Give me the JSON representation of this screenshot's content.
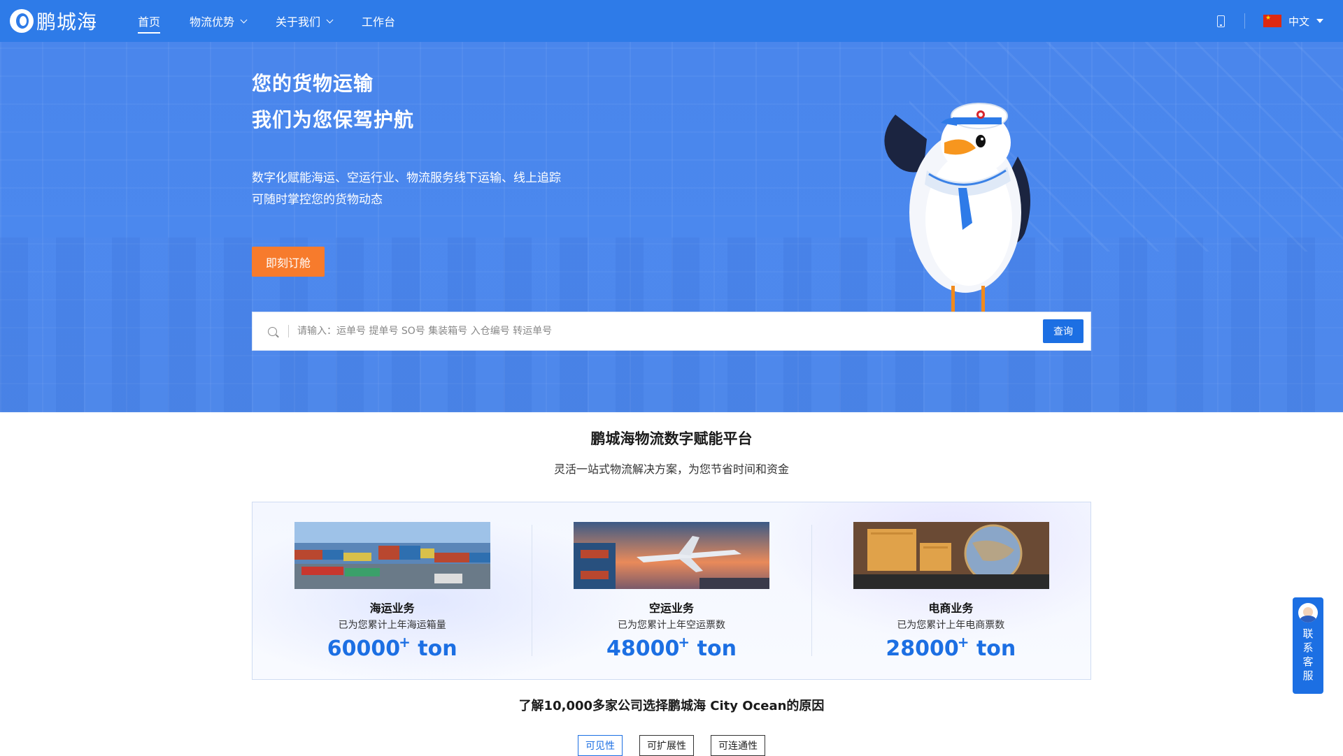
{
  "nav": {
    "logo": "鹏城海",
    "items": [
      {
        "label": "首页",
        "active": true,
        "dropdown": false
      },
      {
        "label": "物流优势",
        "active": false,
        "dropdown": true
      },
      {
        "label": "关于我们",
        "active": false,
        "dropdown": true
      },
      {
        "label": "工作台",
        "active": false,
        "dropdown": false
      }
    ],
    "language": "中文"
  },
  "hero": {
    "title_line1": "您的货物运输",
    "title_line2": "我们为您保驾护航",
    "desc_line1": "数字化赋能海运、空运行业、物流服务线下运输、线上追踪",
    "desc_line2": "可随时掌控您的货物动态",
    "cta_label": "即刻订舱"
  },
  "search": {
    "placeholder": "请输入：运单号 提单号 SO号 集装箱号 入仓编号 转运单号",
    "button_label": "查询"
  },
  "platform": {
    "title": "鹏城海物流数字赋能平台",
    "subtitle": "灵活一站式物流解决方案，为您节省时间和资金",
    "cards": [
      {
        "name": "海运业务",
        "desc": "已为您累计上年海运箱量",
        "number": "60000",
        "plus": "+",
        "unit": "ton"
      },
      {
        "name": "空运业务",
        "desc": "已为您累计上年空运票数",
        "number": "48000",
        "plus": "+",
        "unit": "ton"
      },
      {
        "name": "电商业务",
        "desc": "已为您累计上年电商票数",
        "number": "28000",
        "plus": "+",
        "unit": "ton"
      }
    ]
  },
  "why": {
    "title": "了解10,000多家公司选择鹏城海 City Ocean的原因",
    "tabs": [
      {
        "label": "可见性",
        "active": true
      },
      {
        "label": "可扩展性",
        "active": false
      },
      {
        "label": "可连通性",
        "active": false
      }
    ]
  },
  "support": {
    "label": "联系客服"
  },
  "colors": {
    "brand_blue": "#2e7be8",
    "cta_orange": "#f77b2c",
    "accent_blue": "#1c6fe3"
  }
}
